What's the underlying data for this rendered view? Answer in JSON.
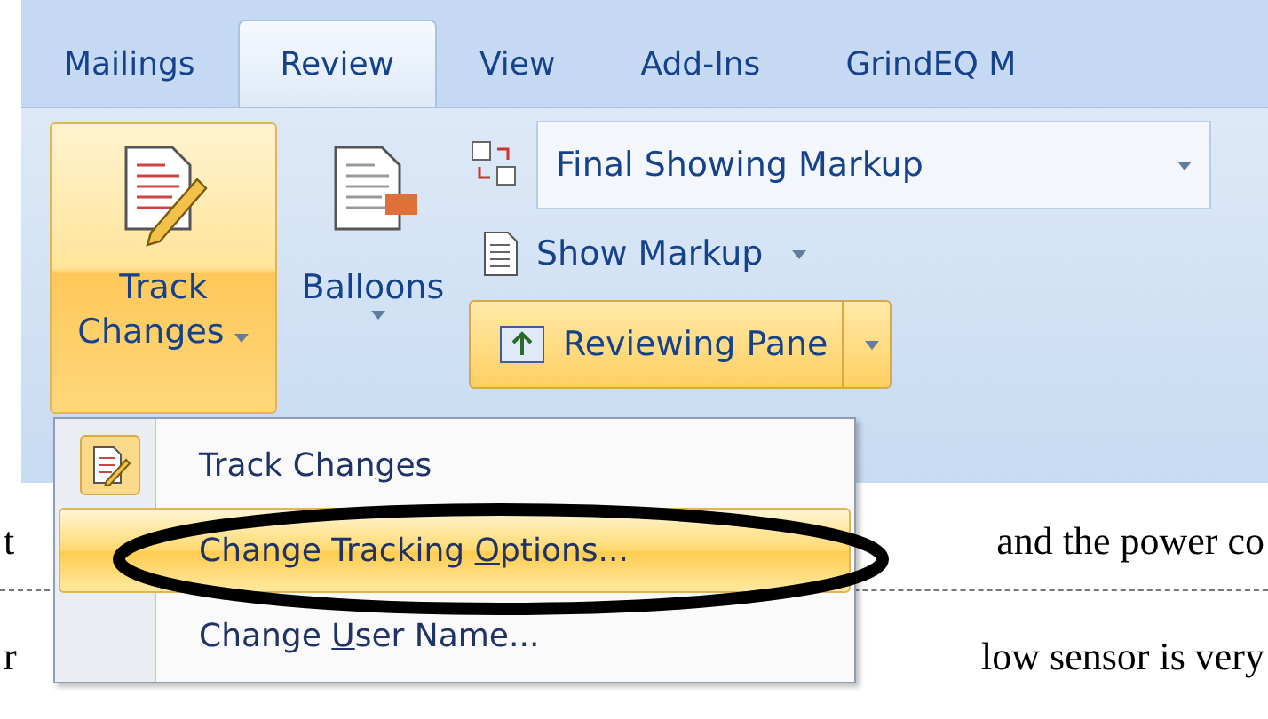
{
  "tabs": [
    {
      "label": "Mailings",
      "selected": false
    },
    {
      "label": "Review",
      "selected": true
    },
    {
      "label": "View",
      "selected": false
    },
    {
      "label": "Add-Ins",
      "selected": false
    },
    {
      "label": "GrindEQ M",
      "selected": false
    }
  ],
  "ribbon": {
    "track_changes": {
      "lines": [
        "Track",
        "Changes"
      ],
      "active": true
    },
    "balloons": {
      "label": "Balloons"
    },
    "display_combo": {
      "value": "Final Showing Markup"
    },
    "show_markup": {
      "label": "Show Markup"
    },
    "reviewing_pane": {
      "label": "Reviewing Pane",
      "highlighted": true
    }
  },
  "menu": {
    "items": [
      {
        "before": "Track Chan",
        "key": "g",
        "after": "es",
        "selected": false,
        "has_icon": true
      },
      {
        "before": "Change Tracking ",
        "key": "O",
        "after": "ptions...",
        "selected": true,
        "has_icon": false
      },
      {
        "before": "Change ",
        "key": "U",
        "after": "ser Name...",
        "selected": false,
        "has_icon": false
      }
    ]
  },
  "document": {
    "lines": [
      {
        "left": "t",
        "right": "and the power co"
      },
      {
        "left": "r",
        "right": "low sensor is very"
      }
    ]
  }
}
